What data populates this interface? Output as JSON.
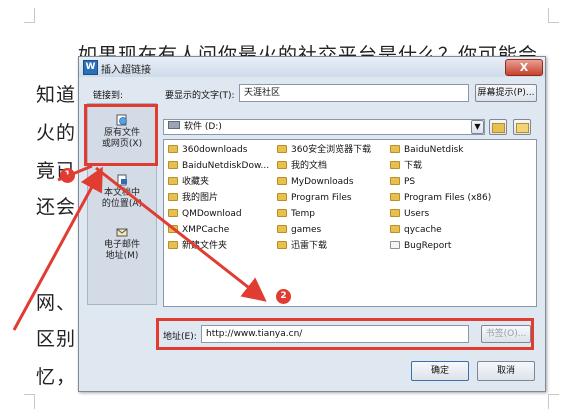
{
  "document": {
    "lines": [
      "如果现在有人问你最火的社交平台是什么？你可能会",
      "知道",
      "火的",
      "竟已",
      "还会",
      "网、",
      "区别",
      "忆，"
    ]
  },
  "dialog": {
    "title": "插入超链接",
    "close_label": "X",
    "link_to_label": "链接到:",
    "display_text_label": "要显示的文字(T):",
    "display_text_value": "天涯社区",
    "screentip_label": "屏幕提示(P)...",
    "nav": [
      {
        "label": "原有文件\n或网页(X)",
        "icon": "globe-file-icon"
      },
      {
        "label": "本文档中\n的位置(A)",
        "icon": "document-place-icon"
      },
      {
        "label": "电子邮件\n地址(M)",
        "icon": "mail-icon"
      }
    ],
    "folder_select": "软件 (D:)",
    "files": [
      {
        "name": "360downloads",
        "kind": "folder"
      },
      {
        "name": "BaiduNetdiskDow...",
        "kind": "folder"
      },
      {
        "name": "收藏夹",
        "kind": "folder"
      },
      {
        "name": "我的图片",
        "kind": "folder"
      },
      {
        "name": "QMDownload",
        "kind": "folder"
      },
      {
        "name": "XMPCache",
        "kind": "folder"
      },
      {
        "name": "新建文件夹",
        "kind": "folder"
      },
      {
        "name": "360安全浏览器下载",
        "kind": "folder"
      },
      {
        "name": "我的文档",
        "kind": "folder"
      },
      {
        "name": "MyDownloads",
        "kind": "folder"
      },
      {
        "name": "Program Files",
        "kind": "folder"
      },
      {
        "name": "Temp",
        "kind": "folder"
      },
      {
        "name": "games",
        "kind": "folder"
      },
      {
        "name": "迅雷下载",
        "kind": "folder"
      },
      {
        "name": "BaiduNetdisk",
        "kind": "folder"
      },
      {
        "name": "下载",
        "kind": "folder"
      },
      {
        "name": "PS",
        "kind": "folder"
      },
      {
        "name": "Program Files (x86)",
        "kind": "folder"
      },
      {
        "name": "Users",
        "kind": "folder"
      },
      {
        "name": "qycache",
        "kind": "folder"
      },
      {
        "name": "BugReport",
        "kind": "file"
      }
    ],
    "address_label": "地址(E):",
    "address_value": "http://www.tianya.cn/",
    "bookmark_label": "书签(O)...",
    "ok_label": "确定",
    "cancel_label": "取消"
  },
  "annotations": {
    "badge_1": "1",
    "badge_2": "2",
    "color": "#e03c32"
  }
}
